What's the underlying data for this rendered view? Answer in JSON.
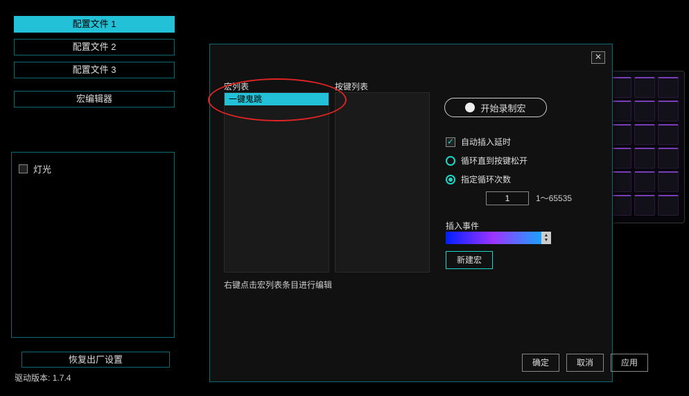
{
  "sidebar": {
    "profiles": [
      "配置文件 1",
      "配置文件 2",
      "配置文件 3"
    ],
    "macro_editor": "宏编辑器",
    "lighting": "灯光",
    "restore": "恢复出厂设置"
  },
  "driver_version_label": "驱动版本:",
  "driver_version_value": "1.7.4",
  "dialog": {
    "macro_list_label": "宏列表",
    "key_list_label": "按键列表",
    "macro_items": [
      "一键鬼跳"
    ],
    "hint": "右键点击宏列表条目进行编辑",
    "record_label": "开始录制宏",
    "auto_delay": "自动插入延时",
    "loop_until_release": "循环直到按键松开",
    "loop_count_label": "指定循环次数",
    "loop_count_value": "1",
    "loop_count_range": "1～65535",
    "insert_event_label": "插入事件",
    "new_macro": "新建宏",
    "ok": "确定",
    "cancel": "取消",
    "apply": "应用"
  }
}
